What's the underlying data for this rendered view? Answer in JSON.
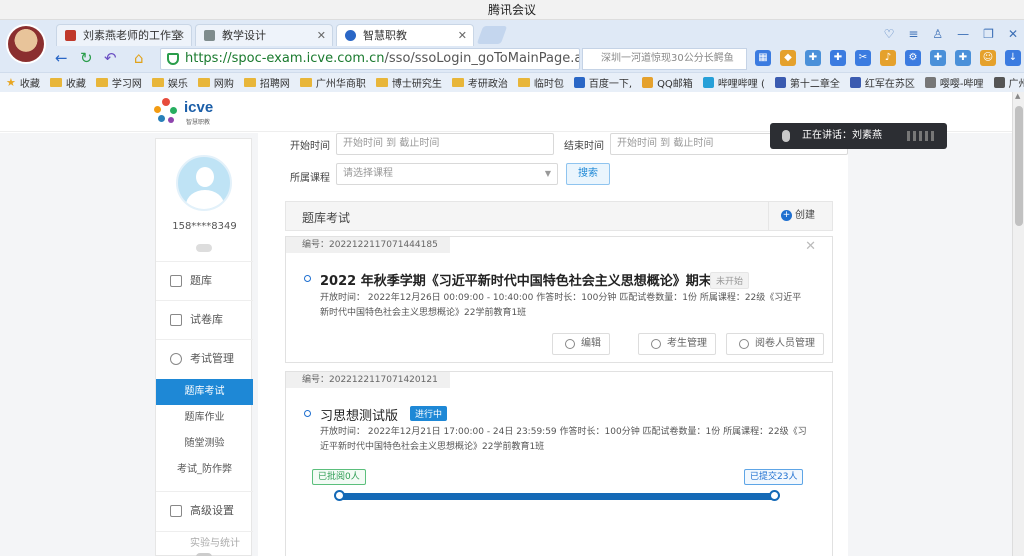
{
  "window": {
    "title": "腾讯会议"
  },
  "browser": {
    "tabs": [
      {
        "label": "刘素燕老师的工作室",
        "color": "#c0392b"
      },
      {
        "label": "教学设计",
        "color": "#7f8c8d"
      },
      {
        "label": "智慧职教",
        "color": "#2a67c6"
      }
    ],
    "url_host": "https://spoc-exam.icve.com.cn",
    "url_path": "/sso/ssoLogin_goToMainPage.a",
    "search_placeholder": "深圳一河道惊现30公分长鳄鱼",
    "bookmarks": [
      {
        "label": "收藏",
        "icon": "star-icon"
      },
      {
        "label": "收藏",
        "icon": "folder-icon"
      },
      {
        "label": "学习网",
        "icon": "folder-icon"
      },
      {
        "label": "娱乐",
        "icon": "folder-icon"
      },
      {
        "label": "网购",
        "icon": "folder-icon"
      },
      {
        "label": "招聘网",
        "icon": "folder-icon"
      },
      {
        "label": "广州华商职",
        "icon": "folder-icon"
      },
      {
        "label": "博士研究生",
        "icon": "folder-icon"
      },
      {
        "label": "考研政治",
        "icon": "folder-icon"
      },
      {
        "label": "临时包",
        "icon": "folder-icon"
      },
      {
        "label": "百度一下,",
        "icon": "site-icon"
      },
      {
        "label": "QQ邮箱",
        "icon": "site-icon"
      },
      {
        "label": "哔哩哔哩 (",
        "icon": "site-icon"
      },
      {
        "label": "第十二章全",
        "icon": "site-icon"
      },
      {
        "label": "红军在苏区",
        "icon": "site-icon"
      },
      {
        "label": "嘤嘤-哔哩",
        "icon": "site-icon"
      },
      {
        "label": "广州图书馆",
        "icon": "site-icon"
      }
    ]
  },
  "page": {
    "logo_word": "icve",
    "logo_sub": "智慧职教",
    "user_phone": "158****8349",
    "sidebar": {
      "items": [
        {
          "label": "题库",
          "icon": "question-bank-icon"
        },
        {
          "label": "试卷库",
          "icon": "paper-library-icon"
        },
        {
          "label": "考试管理",
          "icon": "exam-manage-icon"
        }
      ],
      "sub_items": [
        {
          "label": "题库考试",
          "active": true
        },
        {
          "label": "题库作业",
          "active": false
        },
        {
          "label": "随堂测验",
          "active": false
        },
        {
          "label": "考试_防作弊",
          "active": false
        }
      ],
      "advanced": {
        "label": "高级设置",
        "icon": "settings-icon"
      },
      "cutoff_label": "实验与统计"
    },
    "filters": {
      "start_label": "开始时间",
      "start_placeholder": "开始时间  到  截止时间",
      "end_label": "结束时间",
      "end_placeholder": "开始时间  到  截止时间",
      "course_label": "所属课程",
      "course_placeholder": "请选择课程",
      "search_button": "搜索"
    },
    "section": {
      "title": "题库考试",
      "create_label": "创建"
    },
    "exams": [
      {
        "code": "编号：2022122117071444185",
        "title": "2022 年秋季学期《习近平新时代中国特色社会主义思想概论》期末...",
        "status": "未开始",
        "meta_line1": "开放时间：  2022年12月26日 00:09:00 - 10:40:00  作答时长：100分钟      匹配试卷数量：1份      所属课程：22级《习近平",
        "meta_line2": "新时代中国特色社会主义思想概论》22学前教育1班",
        "actions": [
          "编辑",
          "考生管理",
          "阅卷人员管理"
        ]
      },
      {
        "code": "编号：2022122117071420121",
        "title": "习思想测试版",
        "status": "进行中",
        "meta_line1": "开放时间：  2022年12月21日 17:00:00 - 24日 23:59:59  作答时长：100分钟      匹配试卷数量：1份      所属课程：22级《习",
        "meta_line2": "近平新时代中国特色社会主义思想概论》22学前教育1班",
        "graded_label": "已批阅0人",
        "submitted_label": "已提交23人"
      }
    ]
  },
  "meeting": {
    "speaking_text": "正在讲话：刘素燕"
  },
  "colors": {
    "accent": "#1e88d6",
    "chrome": "#dfe9f6",
    "progress": "#1469b6"
  }
}
